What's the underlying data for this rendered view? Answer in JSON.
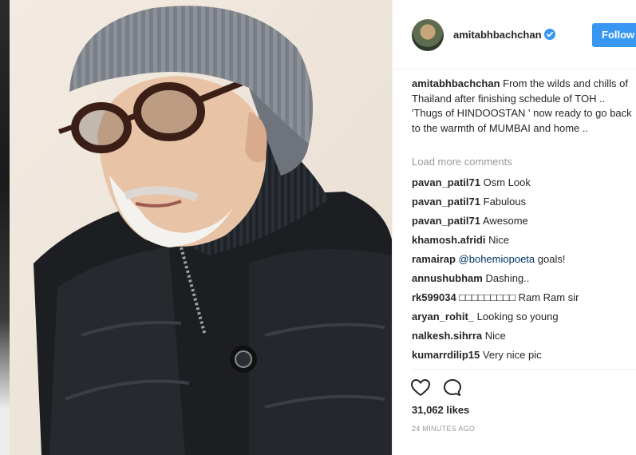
{
  "post": {
    "username": "amitabhbachchan",
    "follow_label": "Follow",
    "caption_user": "amitabhbachchan",
    "caption_text": "From the wilds and chills of Thailand after finishing schedule of TOH .. 'Thugs of HINDOOSTAN ' now ready to go back to the warmth of MUMBAI and home ..",
    "load_more": "Load more comments",
    "likes": "31,062 likes",
    "time": "24 MINUTES AGO"
  },
  "comments": [
    {
      "user": "pavan_patil71",
      "text": "Osm Look"
    },
    {
      "user": "pavan_patil71",
      "text": "Fabulous"
    },
    {
      "user": "pavan_patil71",
      "text": "Awesome"
    },
    {
      "user": "khamosh.afridi",
      "text": "Nice"
    },
    {
      "user": "ramairap",
      "mention": "@bohemiopoeta",
      "text": "goals!"
    },
    {
      "user": "annushubham",
      "text": "Dashing.."
    },
    {
      "user": "rk599034",
      "text": "□□□□□□□□□ Ram Ram sir"
    },
    {
      "user": "aryan_rohit_",
      "text": "Looking so young"
    },
    {
      "user": "nalkesh.sihrra",
      "text": "Nice"
    },
    {
      "user": "kumarrdilip15",
      "text": "Very nice pic"
    }
  ],
  "icons": {
    "verified": "verified-badge-icon",
    "like": "heart-icon",
    "comment": "comment-bubble-icon"
  },
  "colors": {
    "follow_button": "#3897f0",
    "muted": "#999999",
    "mention": "#003569",
    "text": "#262626"
  }
}
